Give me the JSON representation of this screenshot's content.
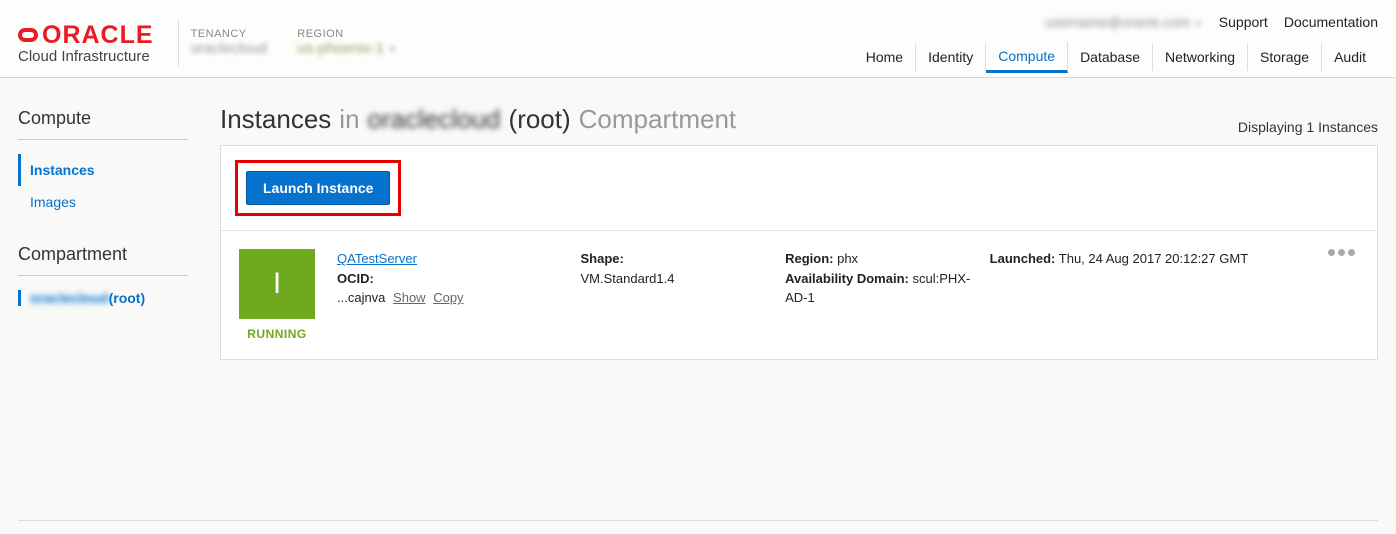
{
  "header": {
    "brand_sub": "Cloud Infrastructure",
    "tenancy_label": "TENANCY",
    "tenancy_value": "oraclecloud",
    "region_label": "REGION",
    "region_value": "us-phoenix-1",
    "user_value": "username@oracle.com",
    "support": "Support",
    "documentation": "Documentation"
  },
  "nav": {
    "home": "Home",
    "identity": "Identity",
    "compute": "Compute",
    "database": "Database",
    "networking": "Networking",
    "storage": "Storage",
    "audit": "Audit"
  },
  "sidebar": {
    "compute_heading": "Compute",
    "instances": "Instances",
    "images": "Images",
    "compartment_heading": "Compartment",
    "compartment_value_blur": "oraclecloud",
    "compartment_suffix": " (root)"
  },
  "page": {
    "title_prefix": "Instances",
    "title_in": " in ",
    "title_compartment_blur": "oraclecloud",
    "title_root": " (root) ",
    "title_compartment_word": "Compartment",
    "displaying": "Displaying 1 Instances",
    "launch_button": "Launch Instance"
  },
  "instance": {
    "icon_letter": "I",
    "status": "RUNNING",
    "name": "QATestServer",
    "ocid_label": "OCID:",
    "ocid_short": "...cajnva",
    "show": "Show",
    "copy": "Copy",
    "shape_label": "Shape:",
    "shape_value": "VM.Standard1.4",
    "region_label": "Region:",
    "region_value": "phx",
    "ad_label": "Availability Domain:",
    "ad_value": "scul:PHX-AD-1",
    "launched_label": "Launched:",
    "launched_value": "Thu, 24 Aug 2017 20:12:27 GMT"
  }
}
